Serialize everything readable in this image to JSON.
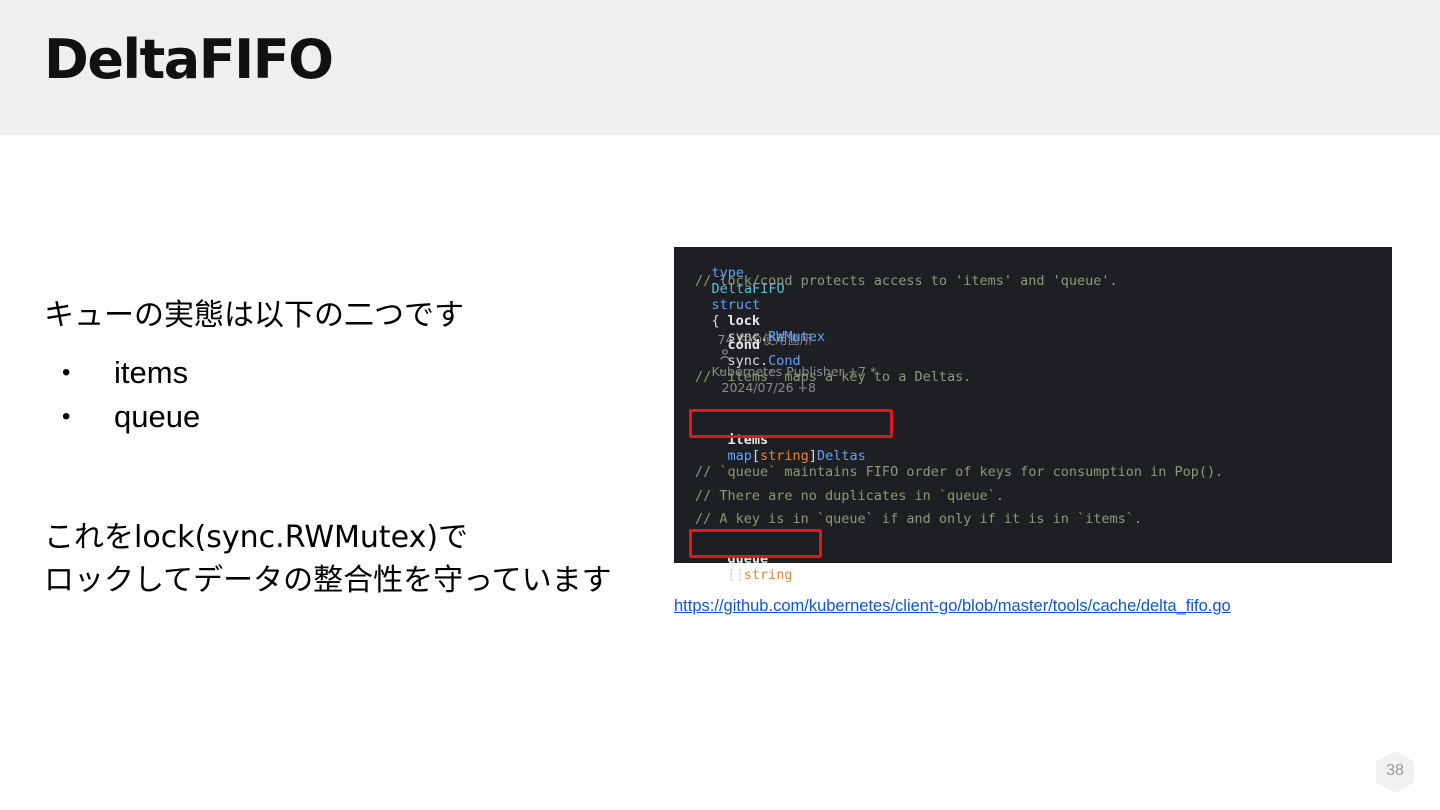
{
  "slide": {
    "title": "DeltaFIFO",
    "intro": "キューの実態は以下の二つです",
    "bullets": [
      "items",
      "queue"
    ],
    "bullet_symbol": "•",
    "body_line1": "これをlock(sync.RWMutex)で",
    "body_line2": "ロックしてデータの整合性を守っています",
    "link_text": "https://github.com/kubernetes/client-go/blob/master/tools/cache/delta_fifo.go",
    "page_number": "38"
  },
  "code": {
    "l1": {
      "kw": "type",
      "name": "DeltaFIFO",
      "kw2": "struct",
      "brace": "{",
      "usages": "74 件の使用箇所",
      "author": "Kubernetes Publisher +7 *",
      "date": "2024/07/26 +8"
    },
    "c1": "// lock/cond protects access to 'items' and 'queue'.",
    "l_lock": {
      "field": "lock",
      "pkg": "sync.",
      "type": "RWMutex"
    },
    "l_cond": {
      "field": "cond",
      "pkg": "sync.",
      "type": "Cond"
    },
    "c2": "// `items` maps a key to a Deltas.",
    "l_items": {
      "field": "items",
      "kw": "map",
      "open": "[",
      "str": "string",
      "close": "]",
      "type": "Deltas"
    },
    "c3": "// `queue` maintains FIFO order of keys for consumption in Pop().",
    "c4": "// There are no duplicates in `queue`.",
    "c5": "// A key is in `queue` if and only if it is in `items`.",
    "l_queue": {
      "field": "queue",
      "brackets": "[]",
      "str": "string"
    }
  },
  "colors": {
    "header_bg": "#efefef",
    "code_bg": "#1e1f22",
    "highlight": "#e0191e",
    "link": "#1155cc"
  },
  "icons": {
    "author": "person-icon",
    "page": "hexagon-badge"
  }
}
